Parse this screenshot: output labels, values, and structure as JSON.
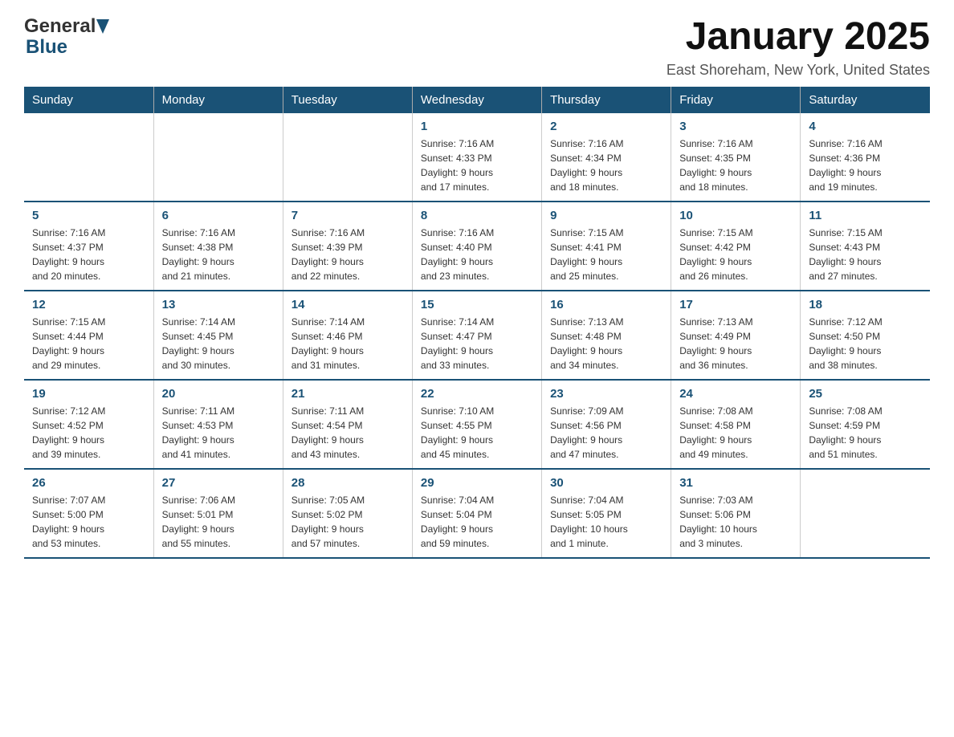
{
  "header": {
    "logo_general": "General",
    "logo_blue": "Blue",
    "month_title": "January 2025",
    "location": "East Shoreham, New York, United States"
  },
  "days_of_week": [
    "Sunday",
    "Monday",
    "Tuesday",
    "Wednesday",
    "Thursday",
    "Friday",
    "Saturday"
  ],
  "weeks": [
    [
      {
        "day": "",
        "info": ""
      },
      {
        "day": "",
        "info": ""
      },
      {
        "day": "",
        "info": ""
      },
      {
        "day": "1",
        "info": "Sunrise: 7:16 AM\nSunset: 4:33 PM\nDaylight: 9 hours\nand 17 minutes."
      },
      {
        "day": "2",
        "info": "Sunrise: 7:16 AM\nSunset: 4:34 PM\nDaylight: 9 hours\nand 18 minutes."
      },
      {
        "day": "3",
        "info": "Sunrise: 7:16 AM\nSunset: 4:35 PM\nDaylight: 9 hours\nand 18 minutes."
      },
      {
        "day": "4",
        "info": "Sunrise: 7:16 AM\nSunset: 4:36 PM\nDaylight: 9 hours\nand 19 minutes."
      }
    ],
    [
      {
        "day": "5",
        "info": "Sunrise: 7:16 AM\nSunset: 4:37 PM\nDaylight: 9 hours\nand 20 minutes."
      },
      {
        "day": "6",
        "info": "Sunrise: 7:16 AM\nSunset: 4:38 PM\nDaylight: 9 hours\nand 21 minutes."
      },
      {
        "day": "7",
        "info": "Sunrise: 7:16 AM\nSunset: 4:39 PM\nDaylight: 9 hours\nand 22 minutes."
      },
      {
        "day": "8",
        "info": "Sunrise: 7:16 AM\nSunset: 4:40 PM\nDaylight: 9 hours\nand 23 minutes."
      },
      {
        "day": "9",
        "info": "Sunrise: 7:15 AM\nSunset: 4:41 PM\nDaylight: 9 hours\nand 25 minutes."
      },
      {
        "day": "10",
        "info": "Sunrise: 7:15 AM\nSunset: 4:42 PM\nDaylight: 9 hours\nand 26 minutes."
      },
      {
        "day": "11",
        "info": "Sunrise: 7:15 AM\nSunset: 4:43 PM\nDaylight: 9 hours\nand 27 minutes."
      }
    ],
    [
      {
        "day": "12",
        "info": "Sunrise: 7:15 AM\nSunset: 4:44 PM\nDaylight: 9 hours\nand 29 minutes."
      },
      {
        "day": "13",
        "info": "Sunrise: 7:14 AM\nSunset: 4:45 PM\nDaylight: 9 hours\nand 30 minutes."
      },
      {
        "day": "14",
        "info": "Sunrise: 7:14 AM\nSunset: 4:46 PM\nDaylight: 9 hours\nand 31 minutes."
      },
      {
        "day": "15",
        "info": "Sunrise: 7:14 AM\nSunset: 4:47 PM\nDaylight: 9 hours\nand 33 minutes."
      },
      {
        "day": "16",
        "info": "Sunrise: 7:13 AM\nSunset: 4:48 PM\nDaylight: 9 hours\nand 34 minutes."
      },
      {
        "day": "17",
        "info": "Sunrise: 7:13 AM\nSunset: 4:49 PM\nDaylight: 9 hours\nand 36 minutes."
      },
      {
        "day": "18",
        "info": "Sunrise: 7:12 AM\nSunset: 4:50 PM\nDaylight: 9 hours\nand 38 minutes."
      }
    ],
    [
      {
        "day": "19",
        "info": "Sunrise: 7:12 AM\nSunset: 4:52 PM\nDaylight: 9 hours\nand 39 minutes."
      },
      {
        "day": "20",
        "info": "Sunrise: 7:11 AM\nSunset: 4:53 PM\nDaylight: 9 hours\nand 41 minutes."
      },
      {
        "day": "21",
        "info": "Sunrise: 7:11 AM\nSunset: 4:54 PM\nDaylight: 9 hours\nand 43 minutes."
      },
      {
        "day": "22",
        "info": "Sunrise: 7:10 AM\nSunset: 4:55 PM\nDaylight: 9 hours\nand 45 minutes."
      },
      {
        "day": "23",
        "info": "Sunrise: 7:09 AM\nSunset: 4:56 PM\nDaylight: 9 hours\nand 47 minutes."
      },
      {
        "day": "24",
        "info": "Sunrise: 7:08 AM\nSunset: 4:58 PM\nDaylight: 9 hours\nand 49 minutes."
      },
      {
        "day": "25",
        "info": "Sunrise: 7:08 AM\nSunset: 4:59 PM\nDaylight: 9 hours\nand 51 minutes."
      }
    ],
    [
      {
        "day": "26",
        "info": "Sunrise: 7:07 AM\nSunset: 5:00 PM\nDaylight: 9 hours\nand 53 minutes."
      },
      {
        "day": "27",
        "info": "Sunrise: 7:06 AM\nSunset: 5:01 PM\nDaylight: 9 hours\nand 55 minutes."
      },
      {
        "day": "28",
        "info": "Sunrise: 7:05 AM\nSunset: 5:02 PM\nDaylight: 9 hours\nand 57 minutes."
      },
      {
        "day": "29",
        "info": "Sunrise: 7:04 AM\nSunset: 5:04 PM\nDaylight: 9 hours\nand 59 minutes."
      },
      {
        "day": "30",
        "info": "Sunrise: 7:04 AM\nSunset: 5:05 PM\nDaylight: 10 hours\nand 1 minute."
      },
      {
        "day": "31",
        "info": "Sunrise: 7:03 AM\nSunset: 5:06 PM\nDaylight: 10 hours\nand 3 minutes."
      },
      {
        "day": "",
        "info": ""
      }
    ]
  ]
}
